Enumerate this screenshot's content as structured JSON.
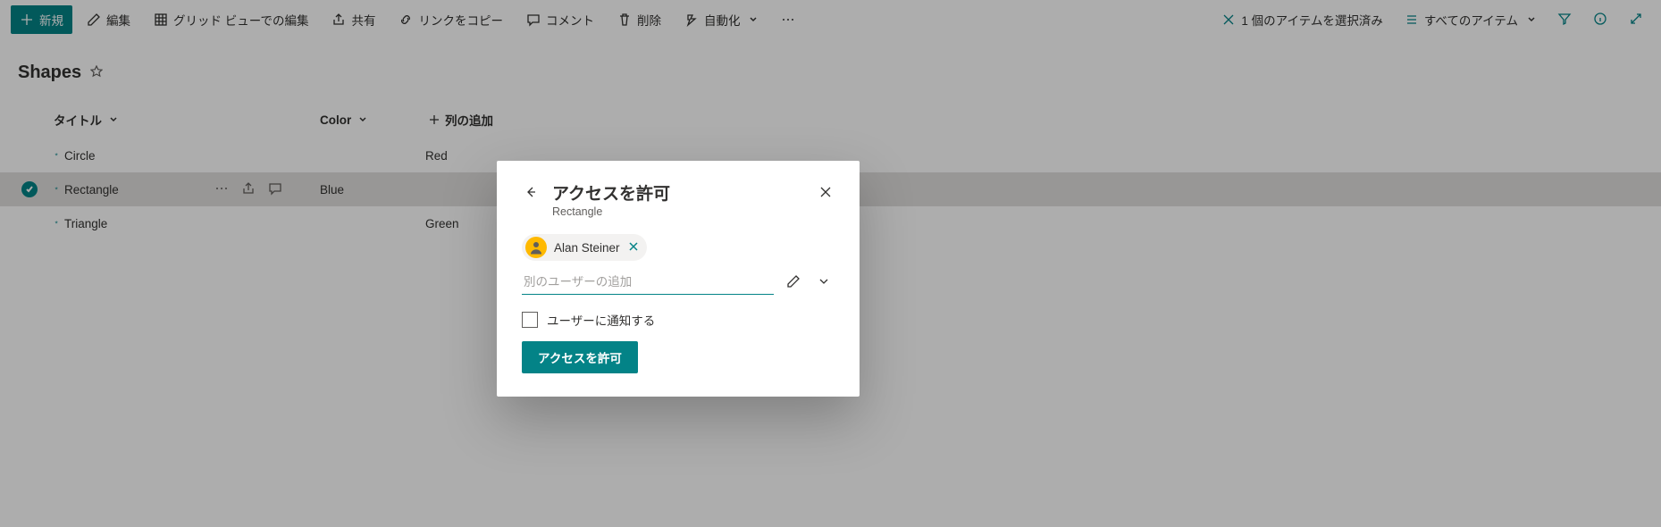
{
  "toolbar": {
    "new": "新規",
    "edit": "編集",
    "gridEdit": "グリッド ビューでの編集",
    "share": "共有",
    "copyLink": "リンクをコピー",
    "comment": "コメント",
    "delete": "削除",
    "automate": "自動化",
    "selectedCount": "1 個のアイテムを選択済み",
    "allItems": "すべてのアイテム"
  },
  "page": {
    "title": "Shapes"
  },
  "columns": {
    "title": "タイトル",
    "color": "Color",
    "add": "列の追加"
  },
  "rows": [
    {
      "title": "Circle",
      "color": "Red",
      "selected": false
    },
    {
      "title": "Rectangle",
      "color": "Blue",
      "selected": true
    },
    {
      "title": "Triangle",
      "color": "Green",
      "selected": false
    }
  ],
  "dialog": {
    "title": "アクセスを許可",
    "subtitle": "Rectangle",
    "personName": "Alan Steiner",
    "addPlaceholder": "別のユーザーの追加",
    "notifyLabel": "ユーザーに通知する",
    "grantButton": "アクセスを許可"
  }
}
